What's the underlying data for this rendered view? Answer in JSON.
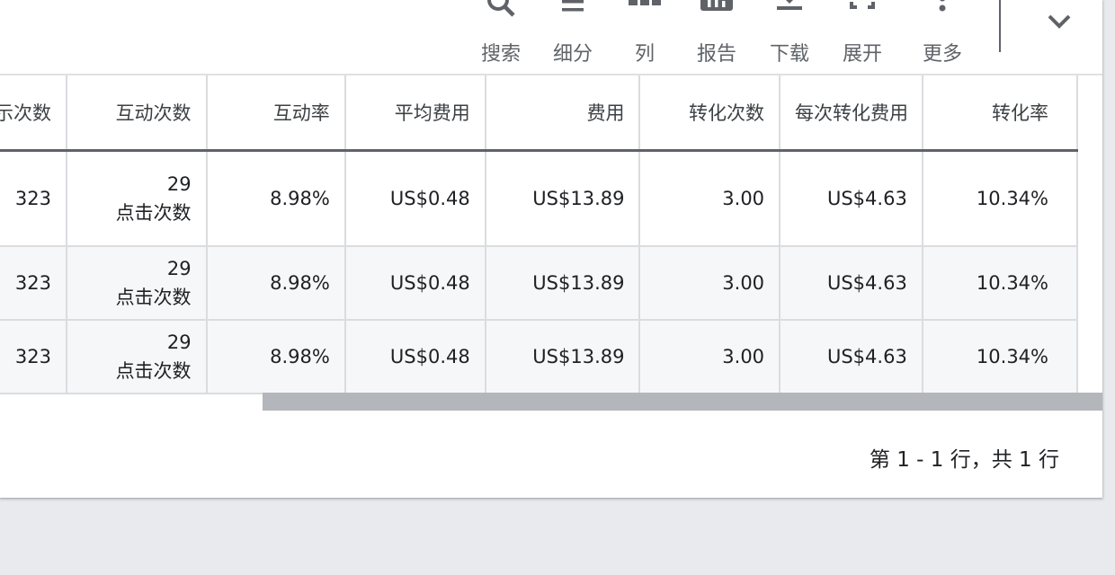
{
  "toolbar": {
    "items": [
      {
        "label": "搜索",
        "icon": "search-icon"
      },
      {
        "label": "细分",
        "icon": "segment-icon"
      },
      {
        "label": "列",
        "icon": "columns-icon"
      },
      {
        "label": "报告",
        "icon": "reports-icon"
      },
      {
        "label": "下载",
        "icon": "download-icon"
      },
      {
        "label": "展开",
        "icon": "fullscreen-icon"
      },
      {
        "label": "更多",
        "icon": "more-vert-icon"
      }
    ],
    "collapse_icon": "chevron-down-icon"
  },
  "table": {
    "headers": [
      "展示次数",
      "互动次数",
      "互动率",
      "平均费用",
      "费用",
      "转化次数",
      "每次转化费用",
      "转化率"
    ],
    "rows": [
      {
        "impressions": "323",
        "interactions": "29",
        "interaction_type": "点击次数",
        "interaction_rate": "8.98%",
        "avg_cost": "US$0.48",
        "cost": "US$13.89",
        "conversions": "3.00",
        "cost_per_conv": "US$4.63",
        "conv_rate": "10.34%"
      },
      {
        "impressions": "323",
        "interactions": "29",
        "interaction_type": "点击次数",
        "interaction_rate": "8.98%",
        "avg_cost": "US$0.48",
        "cost": "US$13.89",
        "conversions": "3.00",
        "cost_per_conv": "US$4.63",
        "conv_rate": "10.34%"
      },
      {
        "impressions": "323",
        "interactions": "29",
        "interaction_type": "点击次数",
        "interaction_rate": "8.98%",
        "avg_cost": "US$0.48",
        "cost": "US$13.89",
        "conversions": "3.00",
        "cost_per_conv": "US$4.63",
        "conv_rate": "10.34%"
      }
    ]
  },
  "pagination": {
    "text": "第 1 - 1 行，共 1 行"
  }
}
